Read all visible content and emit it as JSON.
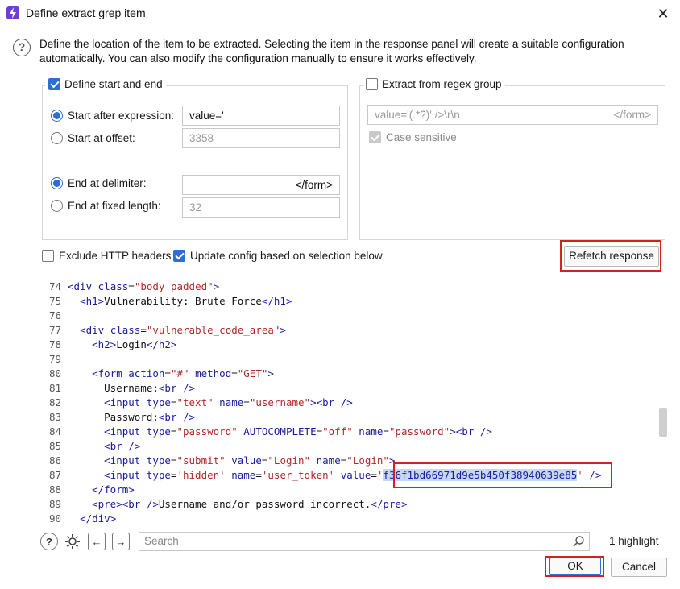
{
  "window": {
    "title": "Define extract grep item",
    "close_label": "✕"
  },
  "description": "Define the location of the item to be extracted. Selecting the item in the response panel will create a suitable configuration automatically. You can also modify the configuration manually to ensure it works effectively.",
  "start_end": {
    "legend": "Define start and end",
    "checked": true,
    "start_after_label": "Start after expression:",
    "start_after_value": "value='",
    "start_offset_label": "Start at offset:",
    "start_offset_value": "3358",
    "end_delim_label": "End at delimiter:",
    "end_delim_value": "</form>",
    "end_fixed_label": "End at fixed length:",
    "end_fixed_value": "32"
  },
  "regex": {
    "legend": "Extract from regex group",
    "checked": false,
    "pattern_start": "value='(.*?)' />\\r\\n",
    "pattern_end": "</form>",
    "case_sensitive_label": "Case sensitive"
  },
  "options": {
    "exclude_headers_label": "Exclude HTTP headers",
    "update_config_label": "Update config based on selection below",
    "refetch_label": "Refetch response"
  },
  "code_lines": [
    {
      "n": "74",
      "html": "div_body"
    },
    {
      "n": "75"
    },
    {
      "n": "76"
    },
    {
      "n": "77"
    },
    {
      "n": "78"
    },
    {
      "n": "79"
    },
    {
      "n": "80"
    },
    {
      "n": "81"
    },
    {
      "n": "82"
    },
    {
      "n": "83"
    },
    {
      "n": "84"
    },
    {
      "n": "85"
    },
    {
      "n": "86"
    },
    {
      "n": "87"
    },
    {
      "n": "88"
    },
    {
      "n": "89"
    },
    {
      "n": "90"
    }
  ],
  "code": {
    "l74": [
      "<div ",
      "class",
      "=",
      "\"body_padded\"",
      ">"
    ],
    "l75_a": "<h1>",
    "l75_b": "Vulnerability: Brute Force",
    "l75_c": "</h1>",
    "l77": [
      "<div ",
      "class",
      "=",
      "\"vulnerable_code_area\"",
      ">"
    ],
    "l78_a": "<h2>",
    "l78_b": "Login",
    "l78_c": "</h2>",
    "l80": [
      "<form ",
      "action",
      "=",
      "\"#\"",
      " method",
      "=",
      "\"GET\"",
      ">"
    ],
    "l81_a": "Username:",
    "l81_b": "<br />",
    "l82": [
      "<input ",
      "type",
      "=",
      "\"text\"",
      " name",
      "=",
      "\"username\"",
      "><br />"
    ],
    "l83_a": "Password:",
    "l83_b": "<br />",
    "l84": [
      "<input ",
      "type",
      "=",
      "\"password\"",
      " AUTOCOMPLETE",
      "=",
      "\"off\"",
      " name",
      "=",
      "\"password\"",
      "><br />"
    ],
    "l85": "<br />",
    "l86": [
      "<input ",
      "type",
      "=",
      "\"submit\"",
      " value",
      "=",
      "\"Login\"",
      " name",
      "=",
      "\"Login\"",
      ">"
    ],
    "l87_pre": [
      "<input ",
      "type",
      "=",
      "'hidden'",
      " name",
      "=",
      "'user_token'",
      " value",
      "="
    ],
    "l87_q1": "'",
    "l87_sel": "f36f1bd66971d9e5b450f38940639e85",
    "l87_q2": "'",
    "l87_end": " />",
    "l88": "</form>",
    "l89_a": "<pre><br />",
    "l89_b": "Username and/or password incorrect.",
    "l89_c": "</pre>",
    "l90": "</div>"
  },
  "search": {
    "placeholder": "Search",
    "highlight_count": "1 highlight"
  },
  "buttons": {
    "ok": "OK",
    "cancel": "Cancel"
  },
  "colors": {
    "accent": "#2b6fd6",
    "highlight_box": "#d32020",
    "selection": "#c5d8f0"
  }
}
